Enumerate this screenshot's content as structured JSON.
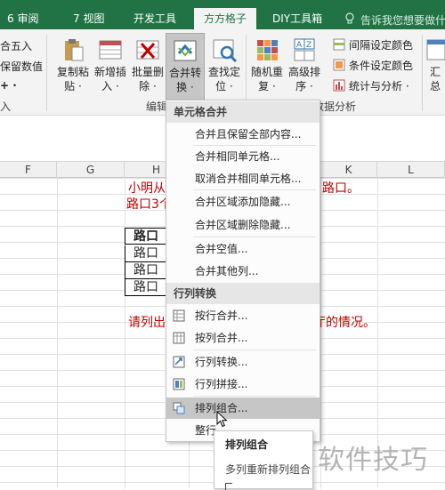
{
  "tabs": {
    "review": "6 审阅",
    "view": "7 视图",
    "developer": "开发工具",
    "fangfang": "方方格子",
    "diy": "DIY工具箱",
    "tell": "告诉我您想要做什么"
  },
  "ribbon": {
    "left_partial": {
      "round": "合五入",
      "keep_value": "保留数值",
      "plus": "+ ·",
      "group": "入"
    },
    "buttons": {
      "copy_paste": [
        "复制粘",
        "贴 ·"
      ],
      "add_insert": [
        "新增插",
        "入 ·"
      ],
      "batch_delete": [
        "批量删",
        "除 ·"
      ],
      "merge_convert": [
        "合并转",
        "换 ·"
      ],
      "find_locate": [
        "查找定",
        "位 ·"
      ],
      "random_repeat": [
        "随机重",
        "复 ·"
      ],
      "advanced_sort": [
        "高级排",
        "序 ·"
      ]
    },
    "edit_group": "编辑",
    "data_analysis_group": "数据分析",
    "small_items": {
      "interval_color": "间隔设定颜色",
      "cond_color": "条件设定颜色",
      "stats": "统计与分析 ·"
    },
    "right_partial": [
      "汇",
      "总"
    ],
    "colors": {
      "tabbar": "#217346",
      "ribbon": "#f3f3f3"
    }
  },
  "columns": [
    "F",
    "G",
    "H",
    "K",
    "L"
  ],
  "sheet": {
    "line1_left": "小明从",
    "line1_right": "路口。",
    "line2_left": "路口3个",
    "line3_left": "请列出",
    "line3_right": "厅的情况。",
    "table_header": "路口",
    "table_rows": [
      "路口",
      "路口",
      "路口"
    ]
  },
  "menu": {
    "header_cell": "单元格合并",
    "cell_items": [
      "合并且保留全部内容...",
      "合并相同单元格...",
      "取消合并相同单元格...",
      "合并区域添加隐藏...",
      "合并区域删除隐藏...",
      "合并空值...",
      "合并其他列..."
    ],
    "header_row": "行列转换",
    "row_items": [
      "按行合并...",
      "按列合并...",
      "行列转换...",
      "行列拼接...",
      "排列组合...",
      "整行"
    ]
  },
  "submenu": {
    "title": "排列组合",
    "desc": "多列重新排列组合"
  },
  "watermark": "软件技巧"
}
